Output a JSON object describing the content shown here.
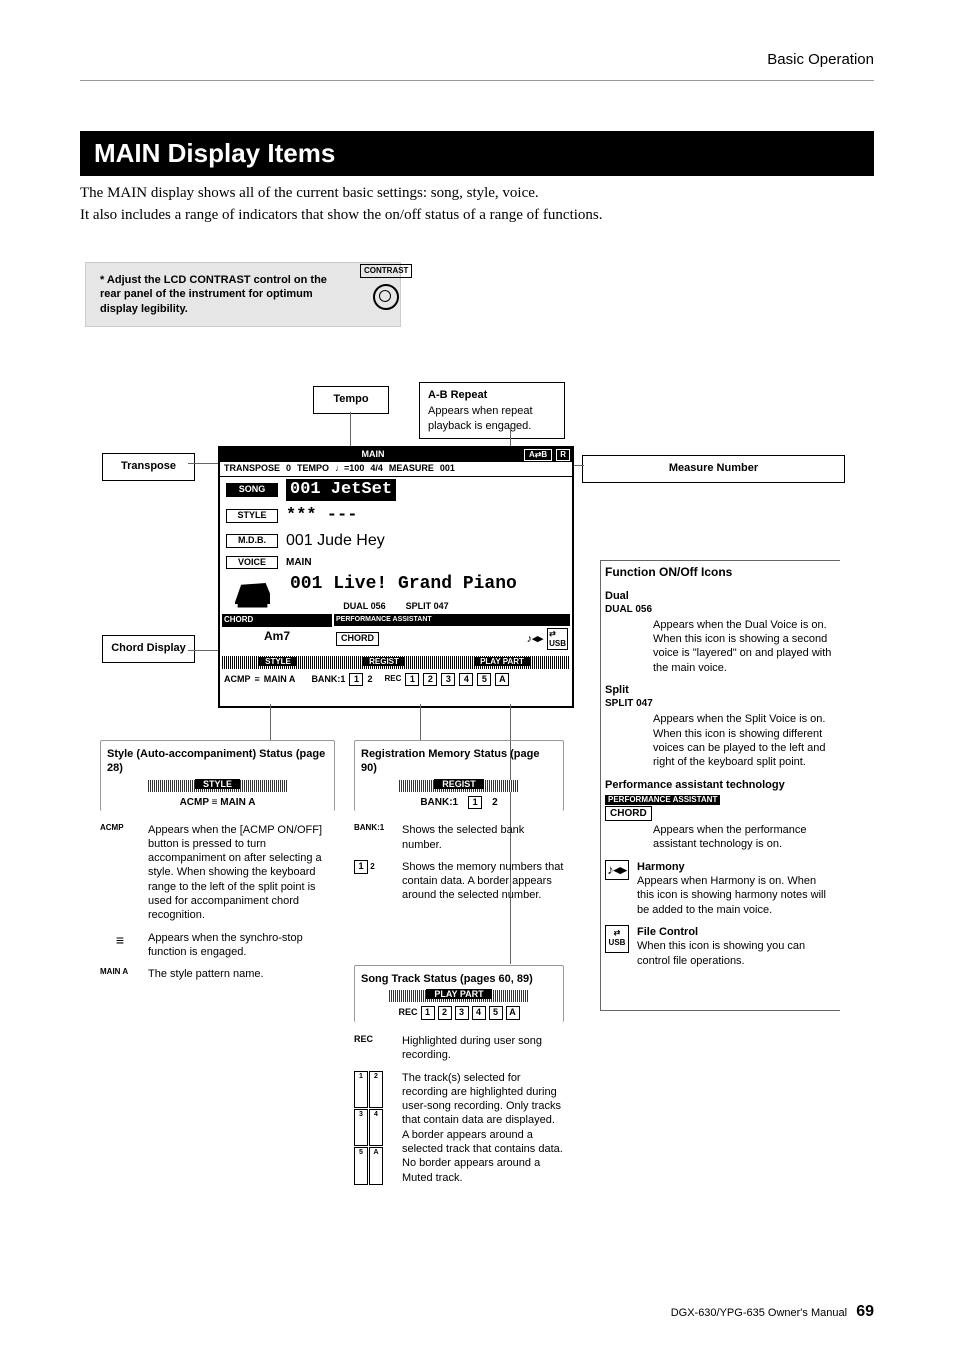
{
  "header": {
    "section": "Basic Operation"
  },
  "title": "MAIN Display Items",
  "intro": {
    "line1": "The MAIN display shows all of the current basic settings: song, style, voice.",
    "line2": "It also includes a range of indicators that show the on/off status of a range of functions."
  },
  "contrast_note": "*  Adjust the LCD CONTRAST control on the rear panel of the instrument for optimum display legibility.",
  "contrast_label": "CONTRAST",
  "callouts": {
    "tempo": "Tempo",
    "ab_title": "A-B Repeat",
    "ab_body": "Appears when repeat playback is engaged.",
    "transpose": "Transpose",
    "measure": "Measure Number",
    "chord_title": "Chord Display"
  },
  "lcd": {
    "main": "MAIN",
    "ab": "A⇄B",
    "r": "R",
    "transpose_label": "TRANSPOSE",
    "transpose_val": "0",
    "tempo_label": "TEMPO",
    "tempo_note": "♩=100",
    "timesig": "4/4",
    "measure_label": "MEASURE",
    "measure_val": "001",
    "song_tag": "SONG",
    "song_val": "001 JetSet",
    "style_tag": "STYLE",
    "style_val": "*** ---",
    "mdb_tag": "M.D.B.",
    "mdb_val": "001 Jude Hey",
    "voice_tag": "VOICE",
    "voice_sub": "MAIN",
    "voice_val": "001 Live! Grand Piano",
    "dual": "DUAL 056",
    "split": "SPLIT 047",
    "chord_hdr": "CHORD",
    "chord_val": "Am7",
    "perf_hdr": "PERFORMANCE ASSISTANT",
    "perf_val": "CHORD",
    "style_hdr": "STYLE",
    "regist_hdr": "REGIST",
    "playpart_hdr": "PLAY PART",
    "acmp": "ACMP",
    "sync_icon": "≡",
    "main_a": "MAIN A",
    "bank": "BANK:1",
    "reg1": "1",
    "reg2": "2",
    "rec": "REC",
    "tracks": [
      "1",
      "2",
      "3",
      "4",
      "5",
      "A"
    ]
  },
  "style_block": {
    "title": "Style (Auto-accompaniment) Status (page 28)",
    "stripe": "STYLE",
    "line": "ACMP ≡ MAIN A",
    "acmp_label": "ACMP",
    "acmp_text": "Appears when the [ACMP ON/OFF] button is pressed to turn accompaniment on after selecting a style. When showing the keyboard range to the left of the split point is used for accompaniment chord recognition.",
    "sync_icon": "≡",
    "sync_text": "Appears when the synchro-stop function is engaged.",
    "maina_label": "MAIN A",
    "maina_text": "The style pattern name."
  },
  "regist_block": {
    "title": "Registration Memory Status (page 90)",
    "stripe": "REGIST",
    "bank_display": "BANK:1",
    "bank_label": "BANK:1",
    "bank_text": "Shows the selected bank number.",
    "mem_label": "1 2",
    "mem_text": "Shows the memory numbers that contain data. A border appears around the selected number."
  },
  "track_block": {
    "title": "Song Track Status (pages 60, 89)",
    "stripe": "PLAY PART",
    "rec_display": "REC 1 2 3 4 5 A",
    "rec_label": "REC",
    "rec_text": "Highlighted during user song recording.",
    "tracks_text": "The track(s) selected for recording are highlighted during user-song recording. Only tracks that contain data are displayed. A border appears around a selected track that contains data. No border appears around a Muted track."
  },
  "func_block": {
    "title": "Function ON/Off Icons",
    "dual_hdr": "Dual",
    "dual_tag": "DUAL 056",
    "dual_text": "Appears when the Dual Voice is on. When this icon is showing a second voice is \"layered\" on and played with the main voice.",
    "split_hdr": "Split",
    "split_tag": "SPLIT 047",
    "split_text": "Appears when the Split Voice is on. When this icon is showing different voices can be played to the left and right of the keyboard split point.",
    "pat_hdr": "Performance assistant technology",
    "pat_tag1": "PERFORMANCE ASSISTANT",
    "pat_tag2": "CHORD",
    "pat_text": "Appears when the performance assistant technology is on.",
    "harm_hdr": "Harmony",
    "harm_text": "Appears when Harmony is on. When this icon is showing harmony notes will be added to the main voice.",
    "file_hdr": "File Control",
    "file_text": "When this icon is showing you can control file operations.",
    "usb": "USB"
  },
  "footer": {
    "manual": "DGX-630/YPG-635  Owner's Manual",
    "page": "69"
  }
}
